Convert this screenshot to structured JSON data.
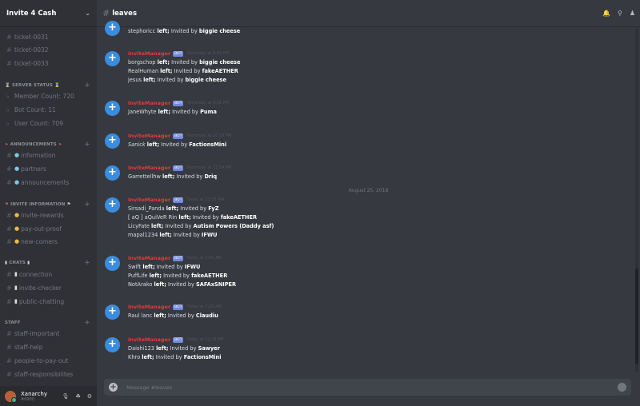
{
  "guild": {
    "name": "Invite 4 Cash"
  },
  "channels_top": [
    {
      "label": "ticket-0031"
    },
    {
      "label": "ticket-0032"
    },
    {
      "label": "ticket-0033"
    }
  ],
  "categories": {
    "server_status": "SERVER STATUS",
    "announcements": "ANNOUNCEMENTS",
    "invite_information": "INVITE INFORMATION",
    "chats": "CHATS",
    "staff": "STAFF"
  },
  "server_status": [
    {
      "label": "Member Count: 720"
    },
    {
      "label": "Bot Count: 11"
    },
    {
      "label": "User Count: 709"
    }
  ],
  "announcements": [
    {
      "label": "information"
    },
    {
      "label": "partners"
    },
    {
      "label": "announcements"
    }
  ],
  "invite_information": [
    {
      "label": "invite-rewards"
    },
    {
      "label": "pay-out-proof"
    },
    {
      "label": "new-comers"
    }
  ],
  "chats": [
    {
      "label": "connection"
    },
    {
      "label": "invite-checker"
    },
    {
      "label": "public-chatting"
    }
  ],
  "staff": [
    {
      "label": "staff-important"
    },
    {
      "label": "staff-help"
    },
    {
      "label": "people-to-pay-out"
    },
    {
      "label": "staff-responsibilites"
    }
  ],
  "user": {
    "name": "Xanarchy",
    "tag": "#6900"
  },
  "channel": {
    "title": "leaves"
  },
  "bot": {
    "name": "InviteManager",
    "badge": "BOT"
  },
  "date_divider": "August 25, 2018",
  "composer": {
    "placeholder": "Message #leaves"
  },
  "messages": [
    {
      "lines": [
        {
          "user": "stephoricc",
          "inviter": "biggie cheese"
        }
      ]
    },
    {
      "timestamp": "Yesterday at 8:59 PM",
      "lines": [
        {
          "user": "borgschop",
          "inviter": "biggie cheese"
        },
        {
          "user": "RealHuman",
          "inviter": "fakeAETHER"
        },
        {
          "user": "jesus",
          "inviter": "biggie cheese"
        }
      ]
    },
    {
      "timestamp": "Yesterday at 9:18 PM",
      "lines": [
        {
          "user": "JaneWhyte",
          "inviter": "Puma"
        }
      ]
    },
    {
      "timestamp": "Yesterday at 10:19 PM",
      "lines": [
        {
          "user": "Sanick",
          "inviter": "FactionsMini"
        }
      ]
    },
    {
      "timestamp": "Yesterday at 11:54 PM",
      "lines": [
        {
          "user": "Garrettellhw",
          "inviter": "Driq"
        }
      ]
    },
    {
      "timestamp": "Today at 12:53 AM",
      "lines": [
        {
          "user": "Sirsadi_Panda",
          "inviter": "FyZ"
        },
        {
          "user": "[ aQ ] aQuiVeR Rin",
          "inviter": "fakeAETHER"
        },
        {
          "user": "LicyFate",
          "inviter": "Autism Powers (Daddy asf)"
        },
        {
          "user": "mapal1234",
          "inviter": "IFWU"
        }
      ]
    },
    {
      "timestamp": "Today at 1:45 AM",
      "lines": [
        {
          "user": "Swift",
          "inviter": "IFWU"
        },
        {
          "user": "PuffLife",
          "inviter": "fakeAETHER"
        },
        {
          "user": "NotArako",
          "inviter": "SAFAxSNIPER"
        }
      ]
    },
    {
      "timestamp": "Today at 7:20 AM",
      "lines": [
        {
          "user": "Raul lanc",
          "inviter": "Claudiu"
        }
      ]
    },
    {
      "timestamp": "Today at 12:29 PM",
      "lines": [
        {
          "user": "Daishi123",
          "inviter": "Sawyer"
        },
        {
          "user": "Khro",
          "inviter": "FactionsMini"
        }
      ]
    }
  ],
  "text": {
    "left": "left;",
    "invited_by": "Invited by"
  },
  "icons": {
    "bell": "bell-icon",
    "pin": "pin-icon",
    "members": "members-icon",
    "mic": "microphone-icon",
    "headset": "headset-icon",
    "gear": "gear-icon"
  }
}
